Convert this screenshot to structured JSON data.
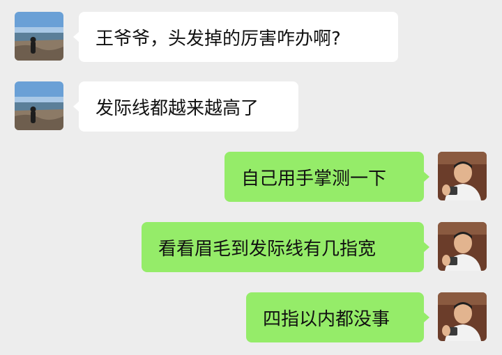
{
  "chat": {
    "messages": [
      {
        "sender": "other",
        "text": "王爷爷，头发掉的厉害咋办啊?"
      },
      {
        "sender": "other",
        "text": "发际线都越来越高了"
      },
      {
        "sender": "self",
        "text": "自己用手掌测一下"
      },
      {
        "sender": "self",
        "text": "看看眉毛到发际线有几指宽"
      },
      {
        "sender": "self",
        "text": "四指以内都没事"
      }
    ]
  },
  "colors": {
    "background": "#ededed",
    "incoming_bubble": "#ffffff",
    "outgoing_bubble": "#95ec69"
  },
  "icons": {
    "other_avatar": "seaside-photo-avatar",
    "self_avatar": "elderly-man-photo-avatar"
  }
}
